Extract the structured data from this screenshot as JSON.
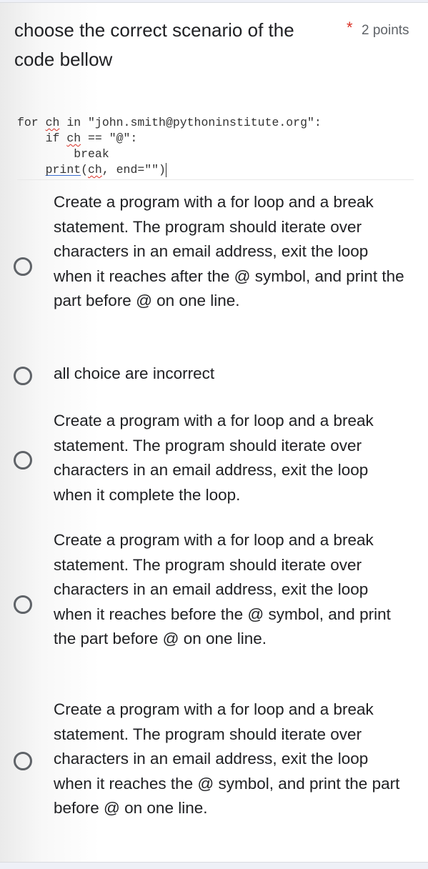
{
  "question": {
    "title": "choose the correct scenario of the code bellow",
    "required_marker": "*",
    "points": "2 points",
    "code_lines": [
      "for ch in \"john.smith@pythoninstitute.org\":",
      "    if ch == \"@\":",
      "        break",
      "    print(ch, end=\"\")"
    ]
  },
  "options": [
    {
      "label": "Create a program with a for loop and a break statement. The program should iterate over characters in an email address, exit the loop when it reaches after the @ symbol, and print the part before @ on one line.",
      "selected": false
    },
    {
      "label": "all choice are incorrect",
      "selected": false
    },
    {
      "label": "Create a program with a for loop and a break statement. The program should iterate over characters in an email address, exit the loop when it complete the loop.",
      "selected": false
    },
    {
      "label": "Create a program with a for loop and a break statement. The program should iterate over characters in an email address, exit the loop when it reaches before the @ symbol, and print the part before @ on one line.",
      "selected": false
    },
    {
      "label": "Create a program with a for loop and a break statement. The program should iterate over characters in an email address, exit the loop when it reaches the @ symbol, and print the part before @ on one line.",
      "selected": false
    }
  ],
  "colors": {
    "required": "#d93025",
    "radio_border": "#5f6368",
    "text": "#202124"
  }
}
